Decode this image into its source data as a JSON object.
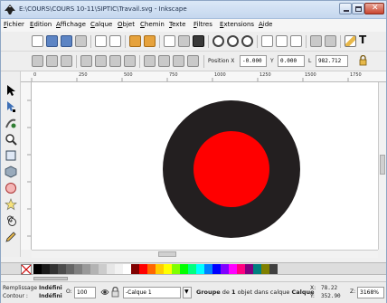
{
  "window": {
    "title": "E:\\COURS\\COURS 10-11\\SIPTIC\\Travail.svg - Inkscape"
  },
  "menu": {
    "items": [
      "Fichier",
      "Edition",
      "Affichage",
      "Calque",
      "Objet",
      "Chemin",
      "Texte",
      "Filtres",
      "Extensions",
      "Aide"
    ]
  },
  "toolbar": {
    "text_tool_label": "T",
    "position_x_label": "Position X",
    "x_value": "-0.000",
    "y_label": "Y",
    "y_value": "0.000",
    "l_label": "L",
    "l_value": "982.712"
  },
  "ruler": {
    "ticks": [
      "0",
      "250",
      "500",
      "750",
      "1000",
      "1250",
      "1500",
      "1750"
    ]
  },
  "canvas": {
    "outer_circle_color": "#231f20",
    "inner_circle_color": "#ff0000"
  },
  "palette": {
    "colors": [
      "#000000",
      "#1a1a1a",
      "#333333",
      "#4d4d4d",
      "#666666",
      "#808080",
      "#999999",
      "#b3b3b3",
      "#cccccc",
      "#e6e6e6",
      "#f2f2f2",
      "#ffffff",
      "#800000",
      "#ff0000",
      "#ff6600",
      "#ffcc00",
      "#ffff00",
      "#80ff00",
      "#00ff00",
      "#00ff80",
      "#00ffff",
      "#0080ff",
      "#0000ff",
      "#8000ff",
      "#ff00ff",
      "#ff0080",
      "#800080",
      "#008080",
      "#808000",
      "#404040"
    ]
  },
  "status": {
    "fill_label": "Remplissage :",
    "fill_value": "Indéfini",
    "stroke_label": "Contour :",
    "stroke_value": "Indéfini",
    "opacity_label": "O:",
    "opacity_value": "100",
    "layer_value": "-Calque 1",
    "message_bold1": "Groupe",
    "message_mid": " de ",
    "message_bold2": "1",
    "message_tail": " objet dans calque ",
    "message_bold3": "Calque",
    "coord_x_label": "X:",
    "coord_x_value": "78.22",
    "coord_y_label": "Y:",
    "coord_y_value": "352.90",
    "zoom_label": "Z:",
    "zoom_value": "3168%"
  }
}
